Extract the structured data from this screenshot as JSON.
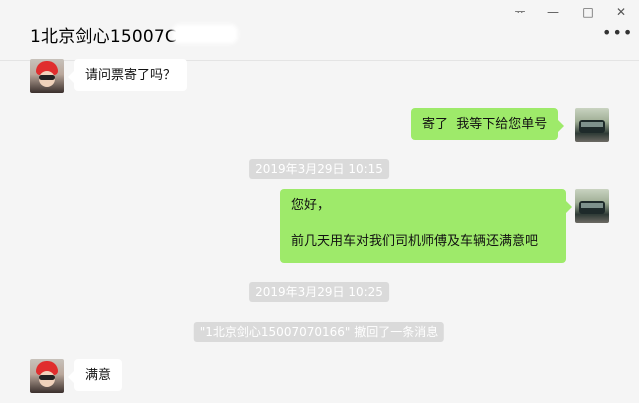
{
  "window": {
    "title": "1北京剑心15007С",
    "controls": {
      "pin": "ᅲ",
      "minimize": "—",
      "maximize": "□",
      "close": "✕"
    },
    "more": "•••"
  },
  "messages": [
    {
      "type": "incoming",
      "text": "请问票寄了吗？"
    },
    {
      "type": "outgoing",
      "text": "寄了  我等下给您单号"
    },
    {
      "type": "timestamp",
      "text": "2019年3月29日 10:15"
    },
    {
      "type": "outgoing",
      "text": "您好，\n\n前几天用车对我们司机师傅及车辆还满意吧"
    },
    {
      "type": "timestamp",
      "text": "2019年3月29日 10:25"
    },
    {
      "type": "system",
      "text": "\"1北京剑心15007070166\" 撤回了一条消息"
    },
    {
      "type": "incoming",
      "text": "满意"
    }
  ],
  "icons": {
    "contact_avatar": "contact-avatar",
    "self_avatar": "self-avatar"
  }
}
